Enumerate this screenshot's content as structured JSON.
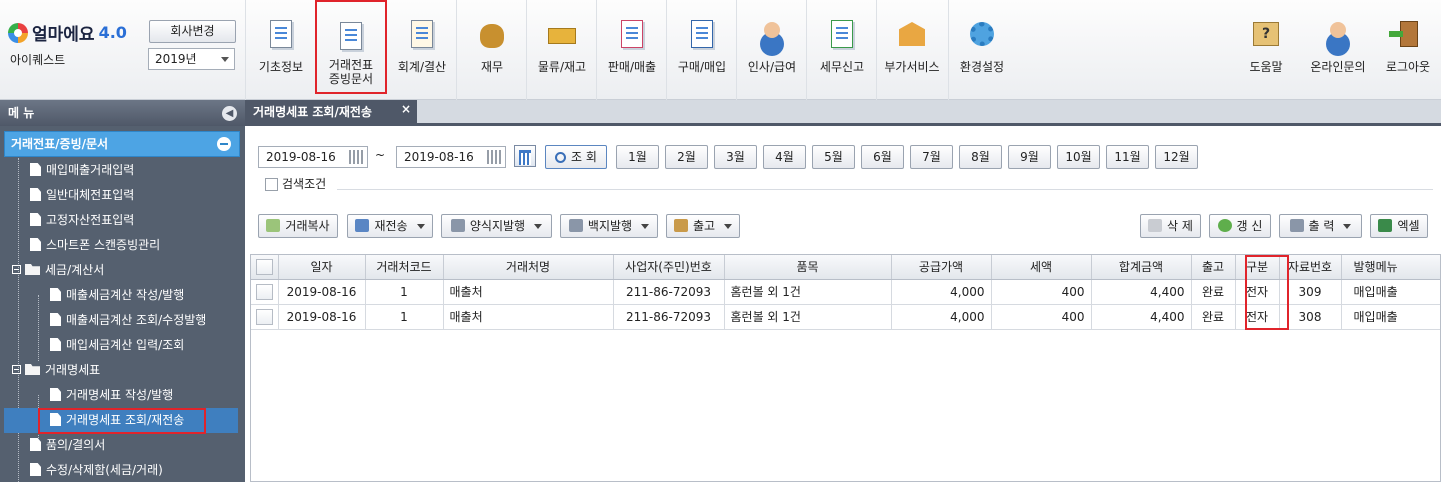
{
  "brand": {
    "name": "얼마에요",
    "version": "4.0"
  },
  "company": {
    "change_button": "회사변경",
    "name": "아이퀘스트",
    "year": "2019년"
  },
  "toolbar": [
    {
      "label": "기초정보",
      "icon": "basic-info-icon"
    },
    {
      "label": "거래전표\n증빙문서",
      "icon": "voucher-icon"
    },
    {
      "label": "회계/결산",
      "icon": "accounting-icon"
    },
    {
      "label": "재무",
      "icon": "finance-icon"
    },
    {
      "label": "물류/재고",
      "icon": "logistics-icon"
    },
    {
      "label": "판매/매출",
      "icon": "sales-icon"
    },
    {
      "label": "구매/매입",
      "icon": "purchase-icon"
    },
    {
      "label": "인사/급여",
      "icon": "hr-icon"
    },
    {
      "label": "세무신고",
      "icon": "tax-icon"
    },
    {
      "label": "부가서비스",
      "icon": "extra-service-icon"
    },
    {
      "label": "환경설정",
      "icon": "settings-icon"
    }
  ],
  "toolbar_right": [
    {
      "label": "도움말",
      "icon": "help-icon"
    },
    {
      "label": "온라인문의",
      "icon": "online-inquiry-icon"
    },
    {
      "label": "로그아웃",
      "icon": "logout-icon"
    }
  ],
  "sidebar": {
    "title": "메 뉴",
    "section": "거래전표/증빙/문서",
    "items": [
      {
        "label": "매입매출거래입력",
        "type": "page",
        "level": 1
      },
      {
        "label": "일반대체전표입력",
        "type": "page",
        "level": 1
      },
      {
        "label": "고정자산전표입력",
        "type": "page",
        "level": 1
      },
      {
        "label": "스마트폰 스캔증빙관리",
        "type": "page",
        "level": 1
      },
      {
        "label": "세금/계산서",
        "type": "folder",
        "level": 1
      },
      {
        "label": "매출세금계산 작성/발행",
        "type": "page",
        "level": 2
      },
      {
        "label": "매출세금계산 조회/수정발행",
        "type": "page",
        "level": 2
      },
      {
        "label": "매입세금계산 입력/조회",
        "type": "page",
        "level": 2
      },
      {
        "label": "거래명세표",
        "type": "folder",
        "level": 1
      },
      {
        "label": "거래명세표 작성/발행",
        "type": "page",
        "level": 2
      },
      {
        "label": "거래명세표 조회/재전송",
        "type": "page",
        "level": 2,
        "active": true
      },
      {
        "label": "품의/결의서",
        "type": "page",
        "level": 1
      },
      {
        "label": "수정/삭제함(세금/거래)",
        "type": "page",
        "level": 1
      }
    ]
  },
  "tab": {
    "title": "거래명세표 조회/재전송",
    "close": "×"
  },
  "filters": {
    "date_from": "2019-08-16",
    "separator": "~",
    "date_to": "2019-08-16",
    "search_label": "조 회",
    "months": [
      "1월",
      "2월",
      "3월",
      "4월",
      "5월",
      "6월",
      "7월",
      "8월",
      "9월",
      "10월",
      "11월",
      "12월"
    ],
    "condition_label": "검색조건"
  },
  "actions": {
    "copy": "거래복사",
    "resend": "재전송",
    "form_issue": "양식지발행",
    "blank_issue": "백지발행",
    "ship": "출고",
    "delete": "삭 제",
    "refresh": "갱 신",
    "print": "출 력",
    "excel": "엑셀"
  },
  "table": {
    "columns": [
      "일자",
      "거래처코드",
      "거래처명",
      "사업자(주민)번호",
      "품목",
      "공급가액",
      "세액",
      "합계금액",
      "출고",
      "구분",
      "자료번호",
      "발행메뉴"
    ],
    "rows": [
      [
        "2019-08-16",
        "1",
        "매출처",
        "211-86-72093",
        "홈런볼 외 1건",
        "4,000",
        "400",
        "4,400",
        "완료",
        "전자",
        "309",
        "매입매출"
      ],
      [
        "2019-08-16",
        "1",
        "매출처",
        "211-86-72093",
        "홈런볼 외 1건",
        "4,000",
        "400",
        "4,400",
        "완료",
        "전자",
        "308",
        "매입매출"
      ]
    ]
  },
  "colors": {
    "highlight": "#e0242b",
    "menu_bg": "#55606f",
    "section_bg": "#4da4e4"
  }
}
